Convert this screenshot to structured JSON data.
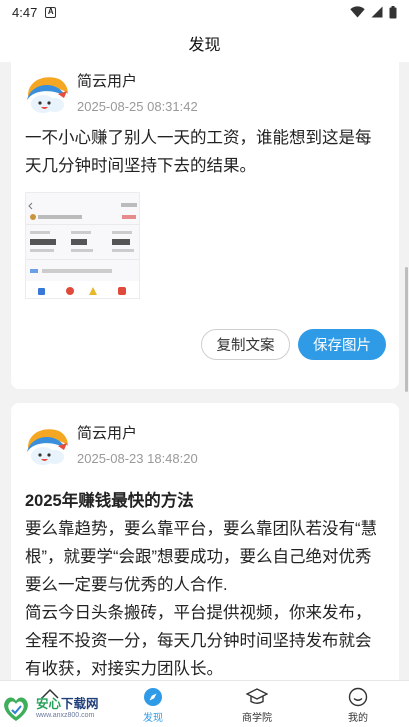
{
  "status_bar": {
    "time": "4:47"
  },
  "header": {
    "title": "发现"
  },
  "posts": [
    {
      "author": "简云用户",
      "time": "2025-08-25 08:31:42",
      "text": "一不小心赚了别人一天的工资，谁能想到这是每天几分钟时间坚持下去的结果。",
      "copy_label": "复制文案",
      "save_label": "保存图片"
    },
    {
      "author": "简云用户",
      "time": "2025-08-23 18:48:20",
      "headline": "2025年赚钱最快的方法",
      "lines": [
        "要么靠趋势，要么靠平台，要么靠团队若没有“慧根”，就要学“会跟”想要成功，要么自己绝对优秀要么一定要与优秀的人合作.",
        "简云今日头条搬砖，平台提供视频，你来发布，全程不投资一分，每天几分钟时间坚持发布就会有收获，对接实力团队长。"
      ]
    }
  ],
  "tabs": [
    {
      "id": "home",
      "label": ""
    },
    {
      "id": "discover",
      "label": "发现"
    },
    {
      "id": "academy",
      "label": "商学院"
    },
    {
      "id": "me",
      "label": "我的"
    }
  ],
  "watermark": {
    "brand_a": "安心",
    "brand_b": "下载网",
    "url": "www.anxz800.com"
  },
  "colors": {
    "accent": "#2f9be6",
    "background": "#f2f2f2"
  }
}
